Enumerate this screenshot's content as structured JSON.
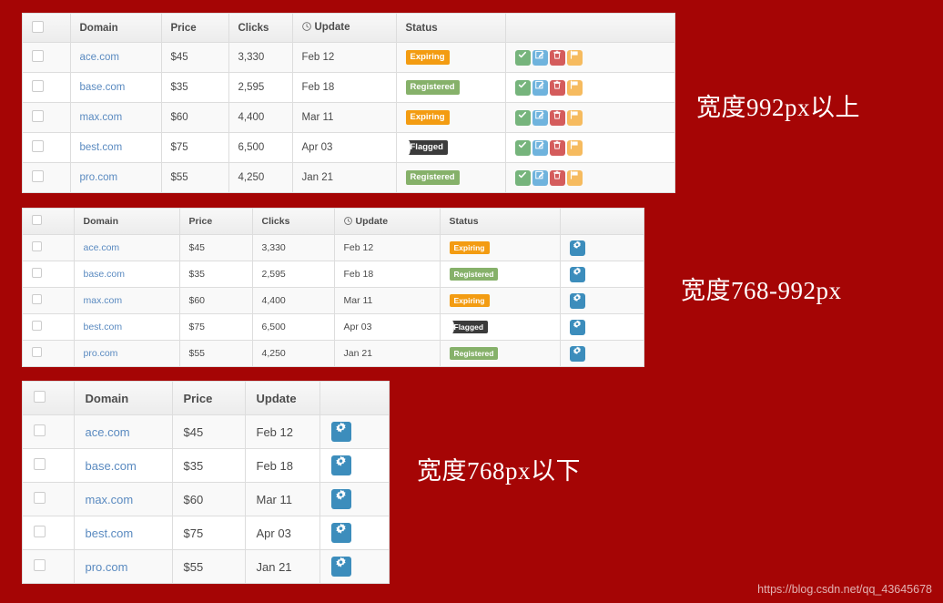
{
  "page": {
    "background_color": "#a50505",
    "watermark": "https://blog.csdn.net/qq_43645678"
  },
  "colors": {
    "background": "#a50505",
    "link": "#5a8ac0",
    "badge_expiring": "#f39c12",
    "badge_registered": "#86b16a",
    "badge_flagged": "#3b3b3b",
    "btn_check": "#76b47c",
    "btn_edit": "#6fb3dd",
    "btn_trash": "#d45c5c",
    "btn_flag": "#f6bb5f",
    "btn_gear": "#3c8dbc"
  },
  "captions": {
    "large": "宽度992px以上",
    "medium": "宽度768-992px",
    "small": "宽度768px以下"
  },
  "tables": {
    "large": {
      "headers": [
        "",
        "Domain",
        "Price",
        "Clicks",
        "Update",
        "Status",
        ""
      ],
      "update_header_icon": "clock-icon",
      "rows": [
        {
          "domain": "ace.com",
          "price": "$45",
          "clicks": "3,330",
          "update": "Feb 12",
          "status": "Expiring",
          "status_type": "expiring"
        },
        {
          "domain": "base.com",
          "price": "$35",
          "clicks": "2,595",
          "update": "Feb 18",
          "status": "Registered",
          "status_type": "registered"
        },
        {
          "domain": "max.com",
          "price": "$60",
          "clicks": "4,400",
          "update": "Mar 11",
          "status": "Expiring",
          "status_type": "expiring"
        },
        {
          "domain": "best.com",
          "price": "$75",
          "clicks": "6,500",
          "update": "Apr 03",
          "status": "Flagged",
          "status_type": "flagged"
        },
        {
          "domain": "pro.com",
          "price": "$55",
          "clicks": "4,250",
          "update": "Jan 21",
          "status": "Registered",
          "status_type": "registered"
        }
      ],
      "actions": [
        "check-icon",
        "edit-icon",
        "trash-icon",
        "flag-icon"
      ]
    },
    "medium": {
      "headers": [
        "",
        "Domain",
        "Price",
        "Clicks",
        "Update",
        "Status",
        ""
      ],
      "update_header_icon": "clock-icon",
      "rows": [
        {
          "domain": "ace.com",
          "price": "$45",
          "clicks": "3,330",
          "update": "Feb 12",
          "status": "Expiring",
          "status_type": "expiring"
        },
        {
          "domain": "base.com",
          "price": "$35",
          "clicks": "2,595",
          "update": "Feb 18",
          "status": "Registered",
          "status_type": "registered"
        },
        {
          "domain": "max.com",
          "price": "$60",
          "clicks": "4,400",
          "update": "Mar 11",
          "status": "Expiring",
          "status_type": "expiring"
        },
        {
          "domain": "best.com",
          "price": "$75",
          "clicks": "6,500",
          "update": "Apr 03",
          "status": "Flagged",
          "status_type": "flagged"
        },
        {
          "domain": "pro.com",
          "price": "$55",
          "clicks": "4,250",
          "update": "Jan 21",
          "status": "Registered",
          "status_type": "registered"
        }
      ],
      "actions": [
        "gear-icon"
      ]
    },
    "small": {
      "headers": [
        "",
        "Domain",
        "Price",
        "Update",
        ""
      ],
      "rows": [
        {
          "domain": "ace.com",
          "price": "$45",
          "update": "Feb 12"
        },
        {
          "domain": "base.com",
          "price": "$35",
          "update": "Feb 18"
        },
        {
          "domain": "max.com",
          "price": "$60",
          "update": "Mar 11"
        },
        {
          "domain": "best.com",
          "price": "$75",
          "update": "Apr 03"
        },
        {
          "domain": "pro.com",
          "price": "$55",
          "update": "Jan 21"
        }
      ],
      "actions": [
        "gear-icon"
      ]
    }
  }
}
